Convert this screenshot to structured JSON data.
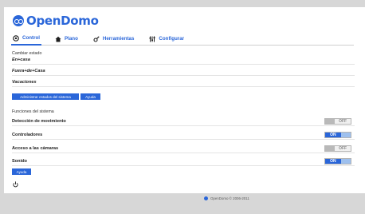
{
  "app": {
    "logo_text": "OpenDomo"
  },
  "tabs": [
    {
      "label": "Control",
      "icon": "gear-icon",
      "active": true
    },
    {
      "label": "Plano",
      "icon": "home-icon",
      "active": false
    },
    {
      "label": "Herramientas",
      "icon": "wrench-icon",
      "active": false
    },
    {
      "label": "Configurar",
      "icon": "sliders-icon",
      "active": false
    }
  ],
  "states": {
    "title": "Cambiar estado",
    "items": [
      "En+casa",
      "Fuera+de+Casa",
      "Vacaciones"
    ],
    "manage_button": "Administrar estados del sistema",
    "help_button": "Ayuda"
  },
  "functions": {
    "title": "Funciones del sistema",
    "items": [
      {
        "label": "Detección de movimiento",
        "state": "OFF"
      },
      {
        "label": "Controladores",
        "state": "ON"
      },
      {
        "label": "Acceso a las cámaras",
        "state": "OFF"
      },
      {
        "label": "Sonido",
        "state": "ON"
      }
    ],
    "help_button": "Ayuda"
  },
  "footer": {
    "text": "OpenDomo © 2006-2011"
  },
  "colors": {
    "accent": "#2a66d9",
    "background": "#d7d7d7"
  }
}
